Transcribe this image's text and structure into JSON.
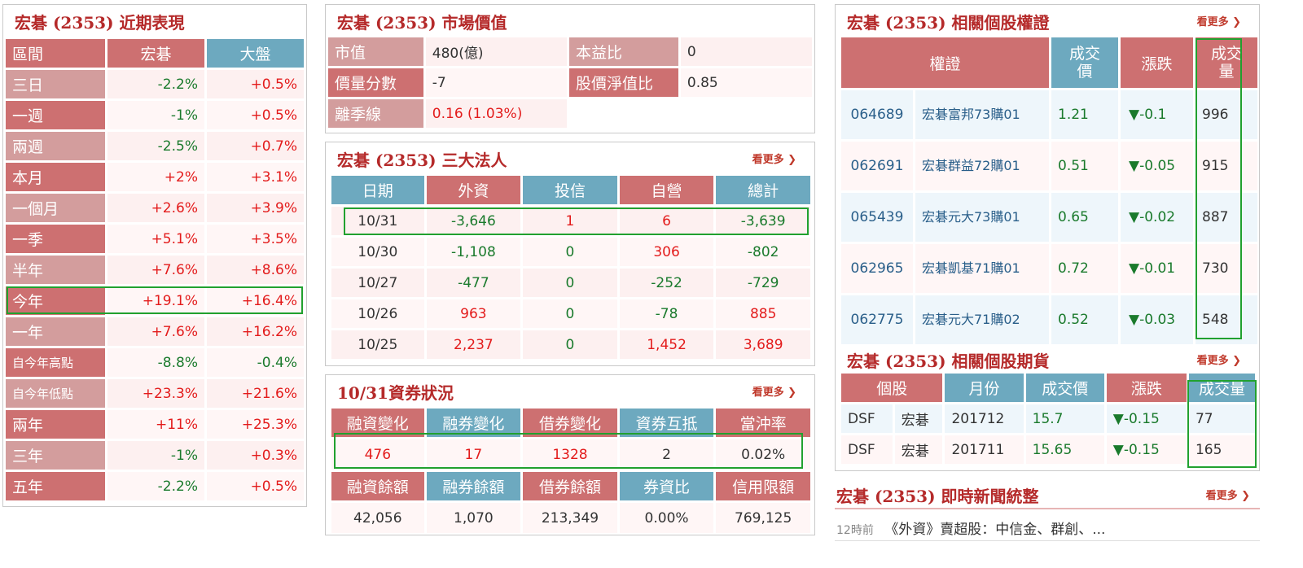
{
  "perf": {
    "title": "宏碁 (2353) 近期表現",
    "headers": [
      "區間",
      "宏碁",
      "大盤"
    ],
    "rows": [
      {
        "label": "三日",
        "stock": "-2.2%",
        "market": "+0.5%"
      },
      {
        "label": "一週",
        "stock": "-1%",
        "market": "+0.5%"
      },
      {
        "label": "兩週",
        "stock": "-2.5%",
        "market": "+0.7%"
      },
      {
        "label": "本月",
        "stock": "+2%",
        "market": "+3.1%"
      },
      {
        "label": "一個月",
        "stock": "+2.6%",
        "market": "+3.9%"
      },
      {
        "label": "一季",
        "stock": "+5.1%",
        "market": "+3.5%"
      },
      {
        "label": "半年",
        "stock": "+7.6%",
        "market": "+8.6%"
      },
      {
        "label": "今年",
        "stock": "+19.1%",
        "market": "+16.4%"
      },
      {
        "label": "一年",
        "stock": "+7.6%",
        "market": "+16.2%"
      },
      {
        "label": "自今年高點",
        "stock": "-8.8%",
        "market": "-0.4%"
      },
      {
        "label": "自今年低點",
        "stock": "+23.3%",
        "market": "+21.6%"
      },
      {
        "label": "兩年",
        "stock": "+11%",
        "market": "+25.3%"
      },
      {
        "label": "三年",
        "stock": "-1%",
        "market": "+0.3%"
      },
      {
        "label": "五年",
        "stock": "-2.2%",
        "market": "+0.5%"
      }
    ]
  },
  "market": {
    "title": "宏碁 (2353) 市場價值",
    "rows": [
      {
        "l1": "市值",
        "v1": "480(億)",
        "l2": "本益比",
        "v2": "0"
      },
      {
        "l1": "價量分數",
        "v1": "-7",
        "l2": "股價淨值比",
        "v2": "0.85"
      },
      {
        "l1": "離季線",
        "v1": "0.16 (1.03%)",
        "l2": "",
        "v2": ""
      }
    ]
  },
  "inst": {
    "title": "宏碁 (2353) 三大法人",
    "more": "看更多 ❯",
    "headers": [
      "日期",
      "外資",
      "投信",
      "自營",
      "總計"
    ],
    "rows": [
      [
        "10/31",
        "-3,646",
        "1",
        "6",
        "-3,639"
      ],
      [
        "10/30",
        "-1,108",
        "0",
        "306",
        "-802"
      ],
      [
        "10/27",
        "-477",
        "0",
        "-252",
        "-729"
      ],
      [
        "10/26",
        "963",
        "0",
        "-78",
        "885"
      ],
      [
        "10/25",
        "2,237",
        "0",
        "1,452",
        "3,689"
      ]
    ]
  },
  "margin": {
    "title": "10/31資券狀況",
    "more": "看更多 ❯",
    "headers1": [
      "融資變化",
      "融券變化",
      "借券變化",
      "資券互抵",
      "當沖率"
    ],
    "values1": [
      "476",
      "17",
      "1328",
      "2",
      "0.02%"
    ],
    "headers2": [
      "融資餘額",
      "融券餘額",
      "借券餘額",
      "券資比",
      "信用限額"
    ],
    "values2": [
      "42,056",
      "1,070",
      "213,349",
      "0.00%",
      "769,125"
    ]
  },
  "warrants": {
    "title": "宏碁 (2353) 相關個股權證",
    "more": "看更多 ❯",
    "headers": [
      "權證",
      "成交價",
      "漲跌",
      "成交量"
    ],
    "rows": [
      {
        "code": "064689",
        "name": "宏碁富邦73購01",
        "price": "1.21",
        "change": "▼-0.1",
        "volume": "996"
      },
      {
        "code": "062691",
        "name": "宏碁群益72購01",
        "price": "0.51",
        "change": "▼-0.05",
        "volume": "915"
      },
      {
        "code": "065439",
        "name": "宏碁元大73購01",
        "price": "0.65",
        "change": "▼-0.02",
        "volume": "887"
      },
      {
        "code": "062965",
        "name": "宏碁凱基71購01",
        "price": "0.72",
        "change": "▼-0.01",
        "volume": "730"
      },
      {
        "code": "062775",
        "name": "宏碁元大71購02",
        "price": "0.52",
        "change": "▼-0.03",
        "volume": "548"
      }
    ]
  },
  "futures": {
    "title": "宏碁 (2353) 相關個股期貨",
    "more": "看更多 ❯",
    "headers": [
      "個股",
      "月份",
      "成交價",
      "漲跌",
      "成交量"
    ],
    "rows": [
      {
        "code": "DSF",
        "name": "宏碁",
        "month": "201712",
        "price": "15.7",
        "change": "▼-0.15",
        "volume": "77"
      },
      {
        "code": "DSF",
        "name": "宏碁",
        "month": "201711",
        "price": "15.65",
        "change": "▼-0.15",
        "volume": "165"
      }
    ]
  },
  "news": {
    "title": "宏碁 (2353) 即時新聞統整",
    "more": "看更多 ❯",
    "time": "12時前",
    "headline": "《外資》賣超股：中信金、群創、..."
  },
  "colors": {
    "header_red": "#cd7071",
    "header_blue": "#6da9bf",
    "up": "#e31b1b",
    "down": "#1a7a2c",
    "highlight": "#21a12f"
  }
}
